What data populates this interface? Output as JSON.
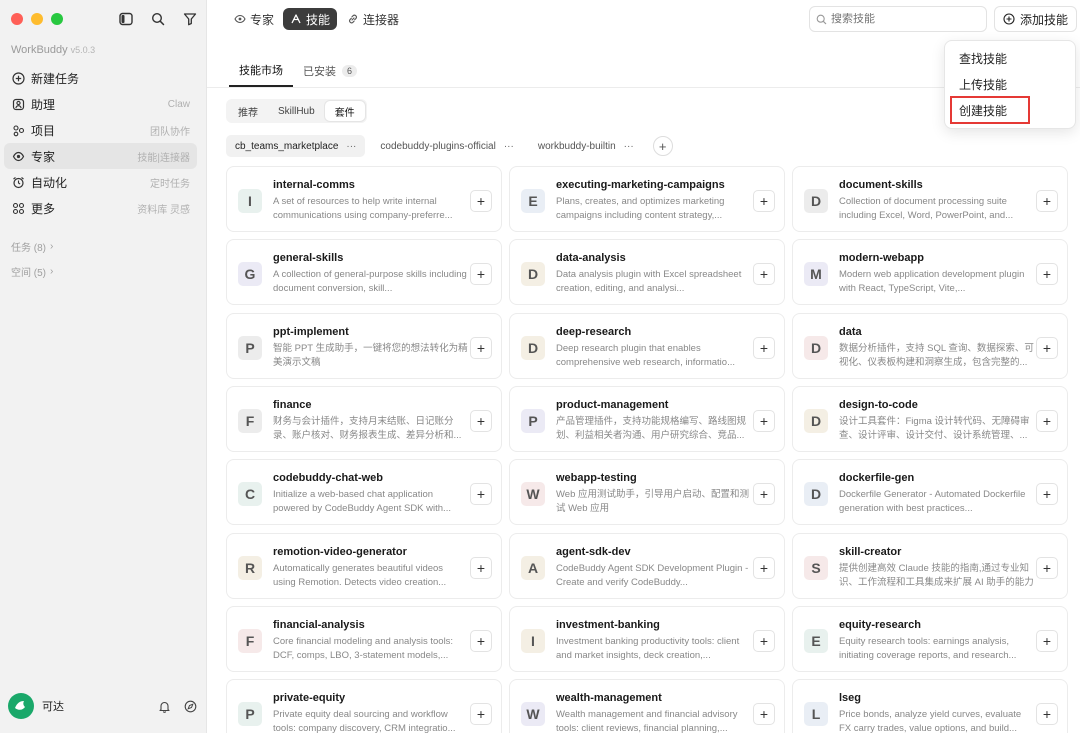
{
  "sidebar": {
    "brand": "WorkBuddy",
    "version": "v5.0.3",
    "nav": [
      {
        "label": "新建任务",
        "sub": "",
        "icon": "plus-circle-icon"
      },
      {
        "label": "助理",
        "sub": "Claw",
        "icon": "assistant-icon"
      },
      {
        "label": "项目",
        "sub": "团队协作",
        "icon": "project-icon"
      },
      {
        "label": "专家",
        "sub": "技能|连接器",
        "icon": "expert-icon"
      },
      {
        "label": "自动化",
        "sub": "定时任务",
        "icon": "alarm-icon"
      },
      {
        "label": "更多",
        "sub": "资料库 灵感",
        "icon": "grid-icon"
      }
    ],
    "groups": [
      "任务 (8)",
      "空间 (5)"
    ],
    "user": "可达"
  },
  "topbar": {
    "tabs": [
      "专家",
      "技能",
      "连接器"
    ],
    "search_placeholder": "搜索技能",
    "add_label": "添加技能"
  },
  "subtabs": [
    {
      "label": "技能市场",
      "badge": ""
    },
    {
      "label": "已安装",
      "badge": "6"
    }
  ],
  "segments": [
    "推荐",
    "SkillHub",
    "套件"
  ],
  "sources": [
    "cb_teams_marketplace",
    "codebuddy-plugins-official",
    "workbuddy-builtin"
  ],
  "dropdown": [
    "查找技能",
    "上传技能",
    "创建技能"
  ],
  "cards": [
    {
      "letter": "I",
      "title": "internal-comms",
      "desc": "A set of resources to help write internal communications using company-preferre...",
      "color": "#e8f1ee"
    },
    {
      "letter": "E",
      "title": "executing-marketing-campaigns",
      "desc": "Plans, creates, and optimizes marketing campaigns including content strategy,...",
      "color": "#e9eef5"
    },
    {
      "letter": "D",
      "title": "document-skills",
      "desc": "Collection of document processing suite including Excel, Word, PowerPoint, and...",
      "color": "#ececec"
    },
    {
      "letter": "G",
      "title": "general-skills",
      "desc": "A collection of general-purpose skills including document conversion, skill...",
      "color": "#ebeaf5"
    },
    {
      "letter": "D",
      "title": "data-analysis",
      "desc": "Data analysis plugin with Excel spreadsheet creation, editing, and analysi...",
      "color": "#f4efe4"
    },
    {
      "letter": "M",
      "title": "modern-webapp",
      "desc": "Modern web application development plugin with React, TypeScript, Vite,...",
      "color": "#ebeaf5"
    },
    {
      "letter": "P",
      "title": "ppt-implement",
      "desc": "智能 PPT 生成助手，一键将您的想法转化为精美演示文稿",
      "color": "#ececec"
    },
    {
      "letter": "D",
      "title": "deep-research",
      "desc": "Deep research plugin that enables comprehensive web research, informatio...",
      "color": "#f4efe4"
    },
    {
      "letter": "D",
      "title": "data",
      "desc": "数据分析插件，支持 SQL 查询、数据探索、可视化、仪表板构建和洞察生成，包含完整的...",
      "color": "#f6e9e9"
    },
    {
      "letter": "F",
      "title": "finance",
      "desc": "财务与会计插件，支持月末结账、日记账分录、账户核对、财务报表生成、差异分析和...",
      "color": "#ececec"
    },
    {
      "letter": "P",
      "title": "product-management",
      "desc": "产品管理插件，支持功能规格编写、路线图规划、利益相关者沟通、用户研究综合、竞品...",
      "color": "#ebeaf5"
    },
    {
      "letter": "D",
      "title": "design-to-code",
      "desc": "设计工具套件：Figma 设计转代码、无障碍审查、设计评审、设计交付、设计系统管理、...",
      "color": "#f4efe4"
    },
    {
      "letter": "C",
      "title": "codebuddy-chat-web",
      "desc": "Initialize a web-based chat application powered by CodeBuddy Agent SDK with...",
      "color": "#e8f1ee"
    },
    {
      "letter": "W",
      "title": "webapp-testing",
      "desc": "Web 应用测试助手，引导用户启动、配置和测试 Web 应用",
      "color": "#f6e9e9"
    },
    {
      "letter": "D",
      "title": "dockerfile-gen",
      "desc": "Dockerfile Generator - Automated Dockerfile generation with best practices...",
      "color": "#e9eef5"
    },
    {
      "letter": "R",
      "title": "remotion-video-generator",
      "desc": "Automatically generates beautiful videos using Remotion. Detects video creation...",
      "color": "#f4efe4"
    },
    {
      "letter": "A",
      "title": "agent-sdk-dev",
      "desc": "CodeBuddy Agent SDK Development Plugin - Create and verify CodeBuddy...",
      "color": "#f4efe4"
    },
    {
      "letter": "S",
      "title": "skill-creator",
      "desc": "提供创建高效 Claude 技能的指南,通过专业知识、工作流程和工具集成来扩展 AI 助手的能力",
      "color": "#f6e9e9"
    },
    {
      "letter": "F",
      "title": "financial-analysis",
      "desc": "Core financial modeling and analysis tools: DCF, comps, LBO, 3-statement models,...",
      "color": "#f6e9e9"
    },
    {
      "letter": "I",
      "title": "investment-banking",
      "desc": "Investment banking productivity tools: client and market insights, deck creation,...",
      "color": "#f4efe4"
    },
    {
      "letter": "E",
      "title": "equity-research",
      "desc": "Equity research tools: earnings analysis, initiating coverage reports, and research...",
      "color": "#e8f1ee"
    },
    {
      "letter": "P",
      "title": "private-equity",
      "desc": "Private equity deal sourcing and workflow tools: company discovery, CRM integratio...",
      "color": "#e8f1ee"
    },
    {
      "letter": "W",
      "title": "wealth-management",
      "desc": "Wealth management and financial advisory tools: client reviews, financial planning,...",
      "color": "#ebeaf5"
    },
    {
      "letter": "L",
      "title": "lseg",
      "desc": "Price bonds, analyze yield curves, evaluate FX carry trades, value options, and build...",
      "color": "#e9eef5"
    }
  ]
}
